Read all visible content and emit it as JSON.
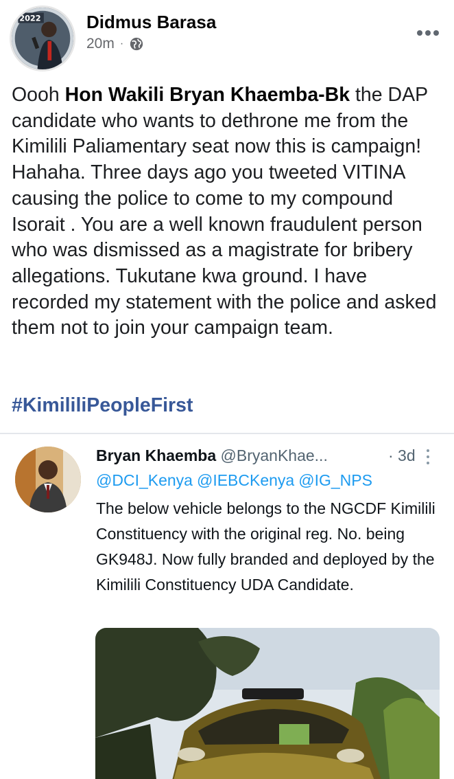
{
  "post": {
    "author": "Didmus Barasa",
    "time": "20m",
    "separator": "·",
    "text_prefix": "Oooh ",
    "text_bold": "Hon Wakili Bryan Khaemba-Bk",
    "text_rest": "  the DAP candidate who wants to dethrone me from the Kimilili Paliamentary seat now this is campaign! Hahaha.  Three days ago you tweeted VITINA causing the police to come to my compound Isorait . You are a well known fraudulent person who was dismissed as a magistrate for bribery allegations. Tukutane kwa ground. I have recorded my statement with the police and asked them not to join your campaign team.",
    "hashtag": "#KimililiPeopleFirst",
    "avatar_badge": "2022",
    "icons": {
      "privacy": "globe-icon",
      "more": "more-options-icon"
    }
  },
  "tweet": {
    "name": "Bryan Khaemba",
    "handle": "@BryanKhae...",
    "time": "· 3d",
    "mentions": [
      "@DCI_Kenya",
      "@IEBCKenya",
      "@IG_NPS"
    ],
    "body": "The below vehicle belongs to the NGCDF Kimilili Constituency with the original reg. No. being GK948J. Now fully branded and deployed by the Kimilili Constituency UDA Candidate."
  },
  "colors": {
    "hashtag": "#385898",
    "mention": "#1d9bf0",
    "meta": "#65676b"
  }
}
